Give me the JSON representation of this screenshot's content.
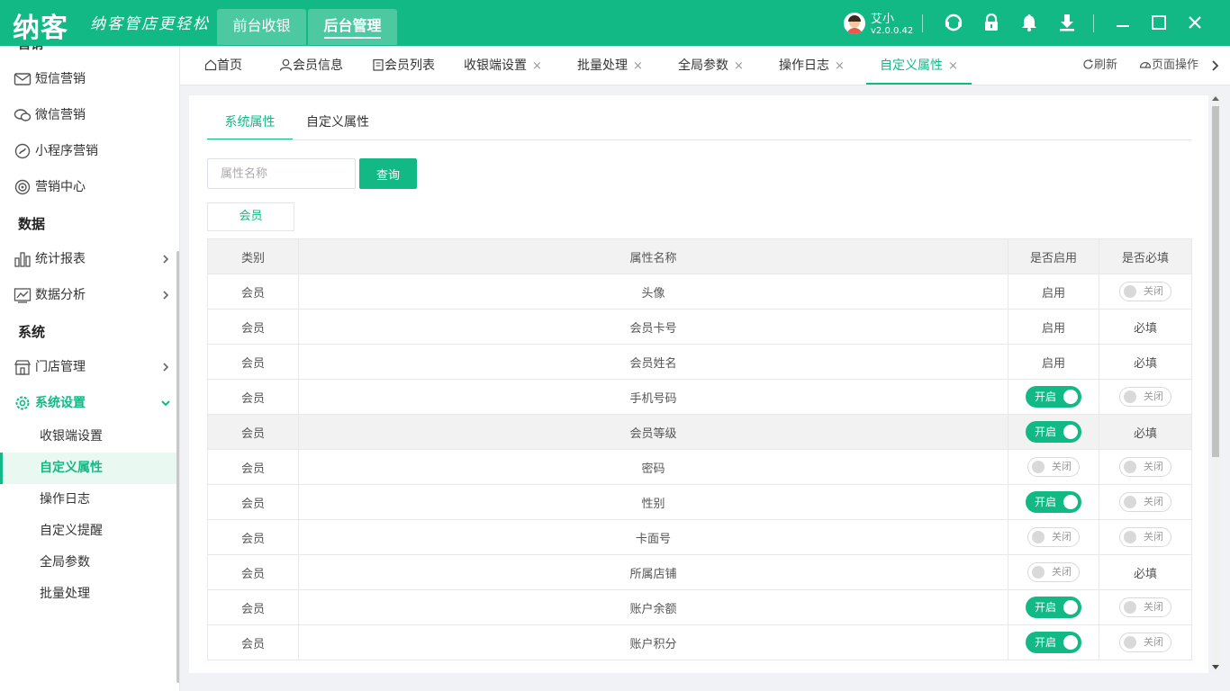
{
  "colors": {
    "primary": "#13b985",
    "tab_bg": "#4cc9a1"
  },
  "topbar": {
    "logo": "纳客",
    "slogan": "纳客管店更轻松",
    "tabs": [
      {
        "label": "前台收银"
      },
      {
        "label": "后台管理"
      }
    ],
    "user": {
      "name": "艾小",
      "version": "v2.0.0.42"
    },
    "icons": [
      "headset-icon",
      "lock-icon",
      "bell-icon",
      "download-icon",
      "minimize-icon",
      "maximize-icon",
      "close-icon"
    ]
  },
  "sidebar": {
    "cut_item": "营销",
    "marketing": [
      {
        "label": "短信营销",
        "icon": "mail-icon"
      },
      {
        "label": "微信营销",
        "icon": "wechat-icon"
      },
      {
        "label": "小程序营销",
        "icon": "miniprogram-icon"
      },
      {
        "label": "营销中心",
        "icon": "target-icon"
      }
    ],
    "section_data": "数据",
    "data_items": [
      {
        "label": "统计报表",
        "icon": "bar-chart-icon"
      },
      {
        "label": "数据分析",
        "icon": "line-chart-icon"
      }
    ],
    "section_system": "系统",
    "system_items": [
      {
        "label": "门店管理",
        "icon": "store-icon"
      },
      {
        "label": "系统设置",
        "icon": "settings-icon"
      }
    ],
    "sub_items": [
      {
        "label": "收银端设置"
      },
      {
        "label": "自定义属性"
      },
      {
        "label": "操作日志"
      },
      {
        "label": "自定义提醒"
      },
      {
        "label": "全局参数"
      },
      {
        "label": "批量处理"
      }
    ]
  },
  "tabbar": {
    "tabs": [
      {
        "label": "首页"
      },
      {
        "label": "会员信息"
      },
      {
        "label": "会员列表"
      },
      {
        "label": "收银端设置"
      },
      {
        "label": "批量处理"
      },
      {
        "label": "全局参数"
      },
      {
        "label": "操作日志"
      },
      {
        "label": "自定义属性"
      }
    ],
    "close_glyph": "×",
    "refresh": "刷新",
    "page_ops": "页面操作"
  },
  "content": {
    "tabs": [
      {
        "label": "系统属性"
      },
      {
        "label": "自定义属性"
      }
    ],
    "search": {
      "placeholder": "属性名称",
      "button": "查询"
    },
    "category_chip": "会员",
    "table": {
      "headers": [
        "类别",
        "属性名称",
        "是否启用",
        "是否必填"
      ],
      "rows": [
        {
          "category": "会员",
          "name": "头像",
          "enabled": "启用",
          "required": "关闭"
        },
        {
          "category": "会员",
          "name": "会员卡号",
          "enabled": "启用",
          "required": "必填"
        },
        {
          "category": "会员",
          "name": "会员姓名",
          "enabled": "启用",
          "required": "必填"
        },
        {
          "category": "会员",
          "name": "手机号码",
          "enabled": "开启",
          "required": "关闭"
        },
        {
          "category": "会员",
          "name": "会员等级",
          "enabled": "开启",
          "required": "必填"
        },
        {
          "category": "会员",
          "name": "密码",
          "enabled": "关闭",
          "required": "关闭"
        },
        {
          "category": "会员",
          "name": "性别",
          "enabled": "开启",
          "required": "关闭"
        },
        {
          "category": "会员",
          "name": "卡面号",
          "enabled": "关闭",
          "required": "关闭"
        },
        {
          "category": "会员",
          "name": "所属店铺",
          "enabled": "关闭",
          "required": "必填"
        },
        {
          "category": "会员",
          "name": "账户余额",
          "enabled": "开启",
          "required": "关闭"
        },
        {
          "category": "会员",
          "name": "账户积分",
          "enabled": "开启",
          "required": "关闭"
        }
      ]
    }
  }
}
